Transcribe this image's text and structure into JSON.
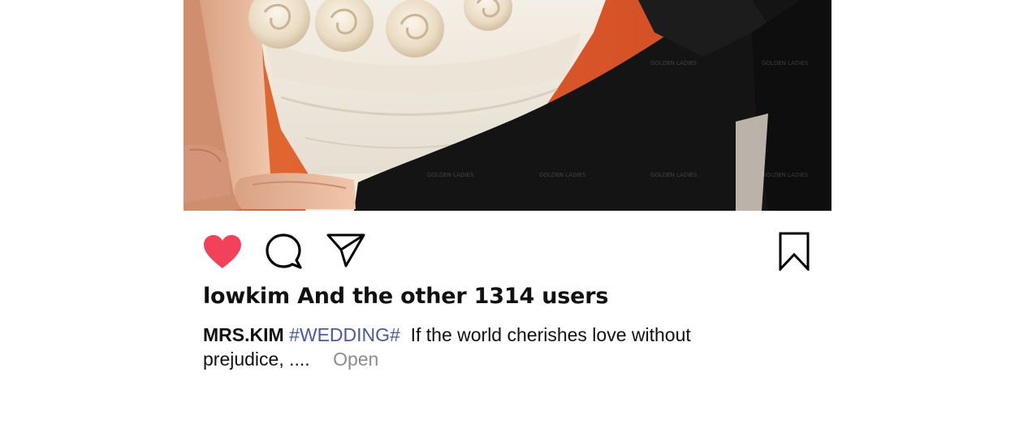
{
  "post": {
    "image_alt": "Couple embracing; bride in white dress with fabric roses, partner in black suit, orange background",
    "watermark": "GOLDEN LADIES",
    "liked": true,
    "icons": {
      "like": "heart-icon",
      "comment": "comment-bubble-icon",
      "share": "paper-plane-icon",
      "save": "bookmark-icon"
    },
    "colors": {
      "like": "#f2425b",
      "hashtag": "#4a5aa0",
      "more": "#8c8c8c",
      "background": "#e8652a"
    },
    "likes_text": "lowkim And the other 1314 users",
    "caption": {
      "username": "MRS.KIM",
      "hashtag": "#WEDDING#",
      "text": "If the world cherishes love without prejudice, ....",
      "more": "Open"
    }
  }
}
